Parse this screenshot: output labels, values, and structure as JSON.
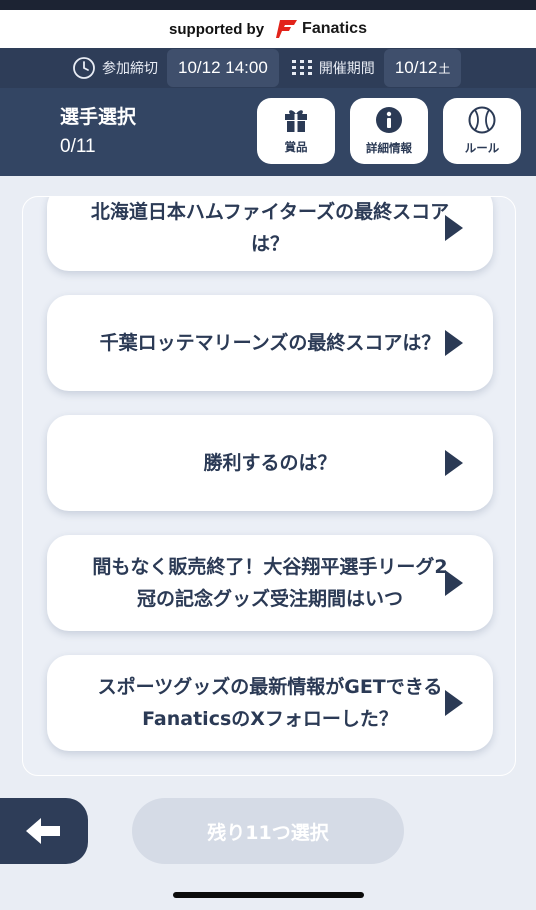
{
  "supported": {
    "text": "supported by",
    "brand": "Fanatics",
    "brand_color": "#e2231a"
  },
  "info_bar": {
    "deadline_label": "参加締切",
    "deadline_value": "10/12 14:00",
    "period_label": "開催期間",
    "period_value": "10/12",
    "period_day": "土"
  },
  "header": {
    "title": "選手選択",
    "count": "0/11",
    "buttons": {
      "prize": "賞品",
      "details": "詳細情報",
      "rules": "ルール"
    }
  },
  "cards": [
    {
      "text": "北海道日本ハムファイターズの最終スコアは？"
    },
    {
      "text": "千葉ロッテマリーンズの最終スコアは？"
    },
    {
      "text": "勝利するのは？"
    },
    {
      "text": "間もなく販売終了！大谷翔平選手リーグ2冠の記念グッズ受注期間はいつ"
    },
    {
      "text": "スポーツグッズの最新情報がGETできるFanaticsのXフォローした？"
    }
  ],
  "footer": {
    "remain_label": "残り11つ選択"
  },
  "colors": {
    "navy": "#2e3d58",
    "header": "#334563",
    "text": "#2b3a55"
  }
}
